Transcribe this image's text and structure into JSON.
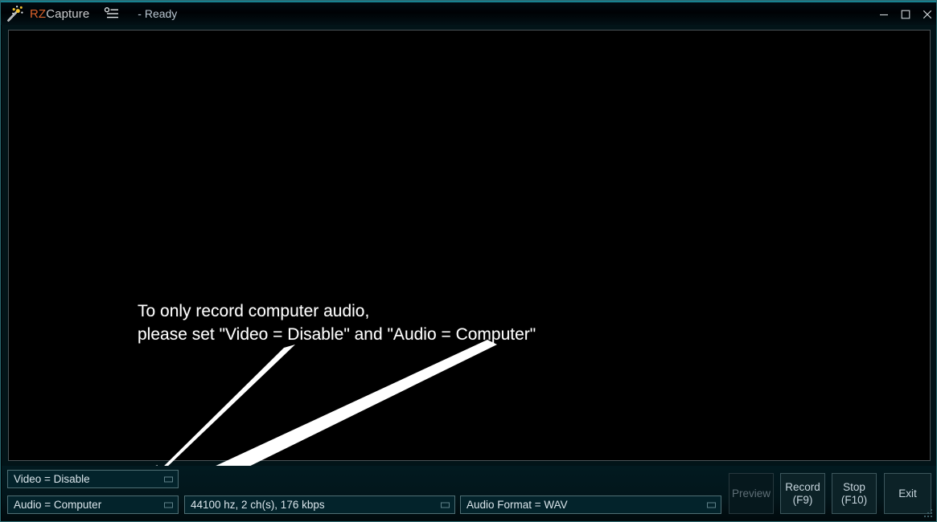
{
  "window": {
    "title_prefix": "RZ",
    "title_suffix": "Capture",
    "status": "- Ready",
    "menu_icon": "options-list-icon",
    "logo_icon": "magic-wand-sparkles-icon",
    "controls": {
      "minimize": "minimize-icon",
      "maximize": "maximize-icon",
      "close": "close-icon"
    },
    "accent_color": "#18808f",
    "title_rz_color": "#d9622b",
    "title_cap_color": "#c9ccce"
  },
  "preview": {
    "background_color": "#000000",
    "overlay_line1": "To only record computer audio,",
    "overlay_line2": "please set \"Video = Disable\" and \"Audio = Computer\"",
    "annotation_arrow_color": "#ffffff"
  },
  "controls": {
    "video_select": {
      "value": "Video = Disable",
      "dropdown_icon": "dropdown-box-icon"
    },
    "audio_select": {
      "value": "Audio = Computer",
      "dropdown_icon": "dropdown-box-icon"
    },
    "quality_select": {
      "value": "44100 hz, 2 ch(s), 176 kbps",
      "dropdown_icon": "dropdown-box-icon"
    },
    "format_select": {
      "value": "Audio Format = WAV",
      "dropdown_icon": "dropdown-box-icon"
    }
  },
  "buttons": {
    "preview": {
      "label": "Preview",
      "enabled": false
    },
    "record": {
      "line1": "Record",
      "line2": "(F9)",
      "enabled": true
    },
    "stop": {
      "line1": "Stop",
      "line2": "(F10)",
      "enabled": true
    },
    "exit": {
      "label": "Exit",
      "enabled": true
    }
  }
}
